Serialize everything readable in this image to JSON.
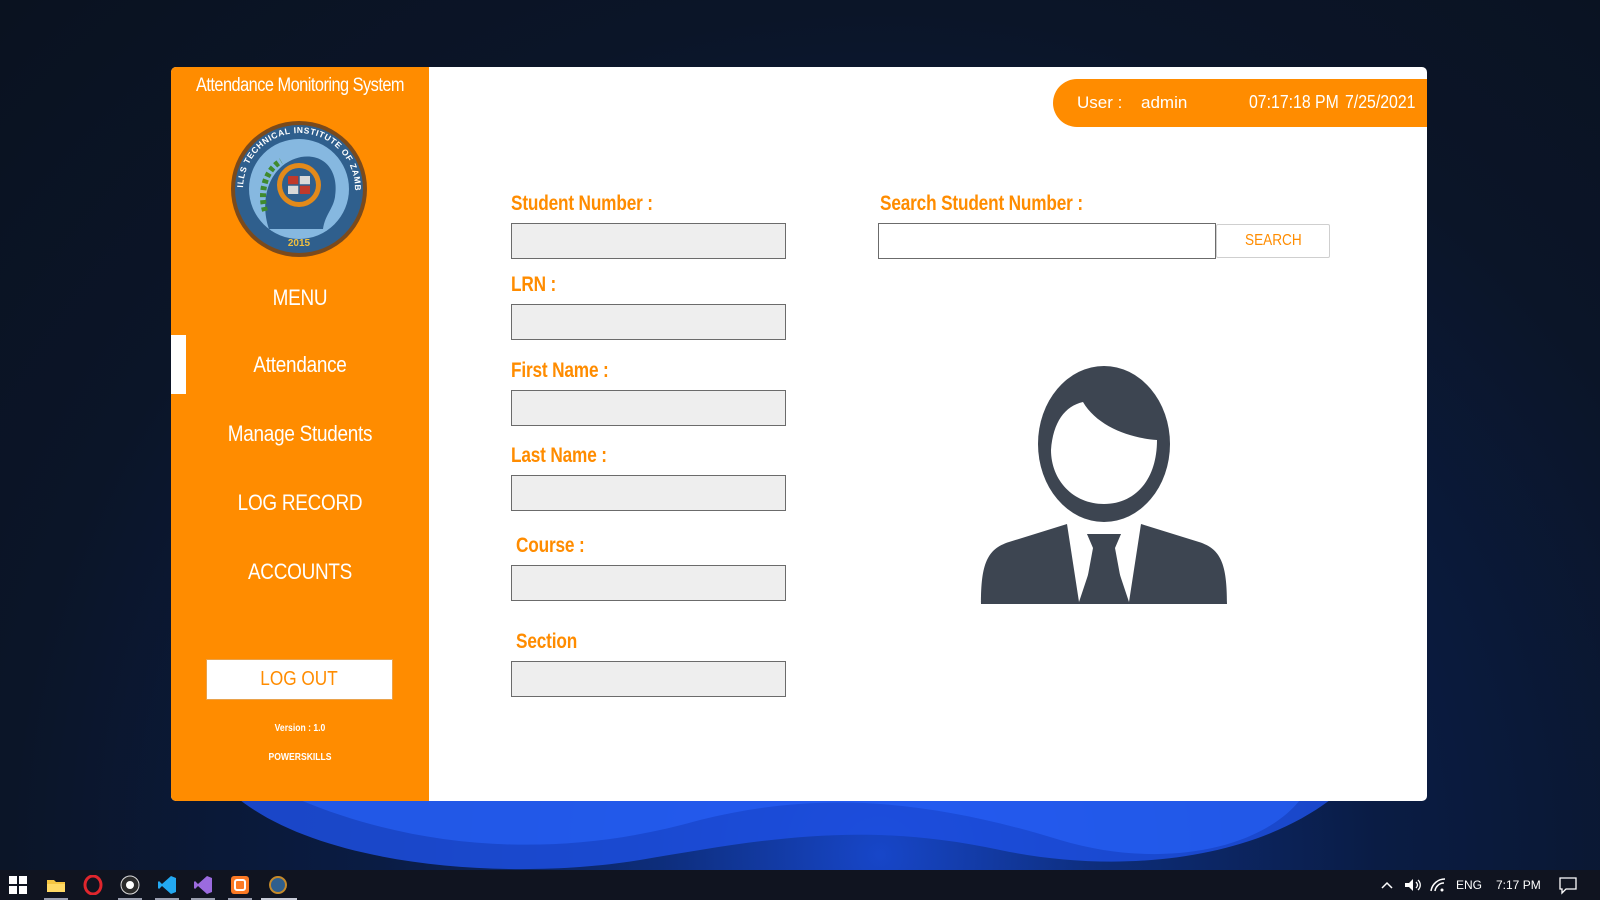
{
  "window": {
    "title": "Attendance Monitoring System"
  },
  "logo": {
    "arc_text": "POWER SKILLS TECHNICAL INSTITUTE OF ZAMBALES INC.",
    "year": "2015"
  },
  "sidebar": {
    "menu_label": "MENU",
    "items": [
      {
        "label": "Attendance",
        "active": true
      },
      {
        "label": "Manage Students",
        "active": false
      },
      {
        "label": "LOG RECORD",
        "active": false
      },
      {
        "label": "ACCOUNTS",
        "active": false
      }
    ],
    "logout_label": "LOG OUT",
    "version": "Version : 1.0",
    "org": "POWERSKILLS"
  },
  "header": {
    "user_label": "User :",
    "user_value": "admin",
    "time": "07:17:18 PM",
    "date": "7/25/2021"
  },
  "form": {
    "student_number_label": "Student Number :",
    "student_number_value": "",
    "lrn_label": "LRN :",
    "lrn_value": "",
    "first_name_label": "First Name :",
    "first_name_value": "",
    "last_name_label": "Last Name :",
    "last_name_value": "",
    "course_label": "Course :",
    "course_value": "",
    "section_label": "Section",
    "section_value": ""
  },
  "search": {
    "label": "Search Student Number :",
    "value": "",
    "button_label": "SEARCH"
  },
  "taskbar": {
    "apps": [
      "start-icon",
      "file-explorer-icon",
      "opera-icon",
      "obs-icon",
      "vscode-icon",
      "visual-studio-icon",
      "xampp-icon",
      "attendance-app-icon"
    ],
    "language": "ENG",
    "clock": "7:17 PM"
  },
  "colors": {
    "accent": "#ff8c00",
    "field_bg": "#eeeeee",
    "avatar": "#3d4551"
  }
}
